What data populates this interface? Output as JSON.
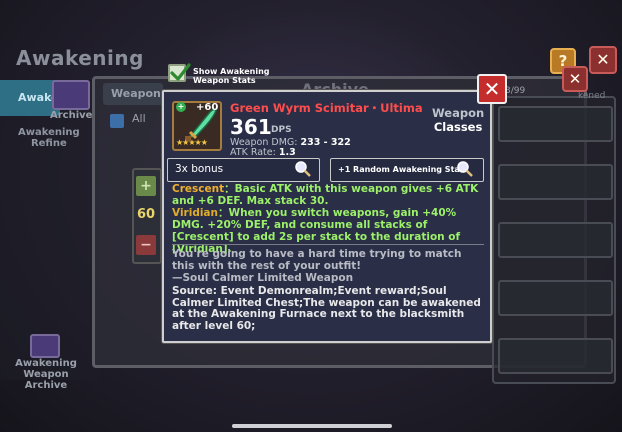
{
  "background": {
    "title": "Awakening",
    "sidebar_tab": "Awake",
    "sidebar_refine": "Awakening\nRefine",
    "archive_label": "Archive",
    "bottom_archive_label": "Awakening\nWeapon Archive",
    "weapon_tab": "Weapon",
    "all_filter": "All",
    "archive_title": "Archive",
    "count_text": "3/99",
    "awakened_text": "kened",
    "quantity": "60",
    "help_icon": "?",
    "close_icon": "✕"
  },
  "toggle": {
    "label_line1": "Show Awakening",
    "label_line2": "Weapon Stats",
    "checked": true
  },
  "modal": {
    "close_icon": "✕",
    "item": {
      "level": "+60",
      "plus_badge": "+",
      "name": "Green Wyrm Scimitar・Ultima",
      "dps_value": "361",
      "dps_label": "DPS",
      "dmg_label": "Weapon DMG:",
      "dmg_value": "233 - 322",
      "rate_label": "ATK Rate:",
      "rate_value": "1.3",
      "stars": "★★★★★",
      "name_color": "#ff4d4d"
    },
    "weapon_classes": {
      "line1": "Weapon",
      "line2": "Classes"
    },
    "bonus": {
      "label": "3x bonus"
    },
    "random_stats": {
      "label": "+1 Random Awakening Stats"
    },
    "effects": [
      {
        "name": "Crescent",
        "text": "：Basic ATK with this weapon gives +6 ATK and +6 DEF. Max stack 30."
      },
      {
        "name": "Viridian",
        "text": "：When you switch weapons, gain +40% DMG. +20% DEF, and consume all stacks of [Crescent] to add 2s per stack to the duration of [Viridian]."
      }
    ],
    "flavor_text": "You're going to have a hard time trying to match this with the rest of your outfit!",
    "flavor_source": "—Soul Calmer Limited Weapon",
    "source_text": "Source: Event Demonrealm;Event reward;Soul Calmer Limited Chest;The weapon can be awakened at the Awakening Furnace next to the blacksmith after level 60;"
  }
}
